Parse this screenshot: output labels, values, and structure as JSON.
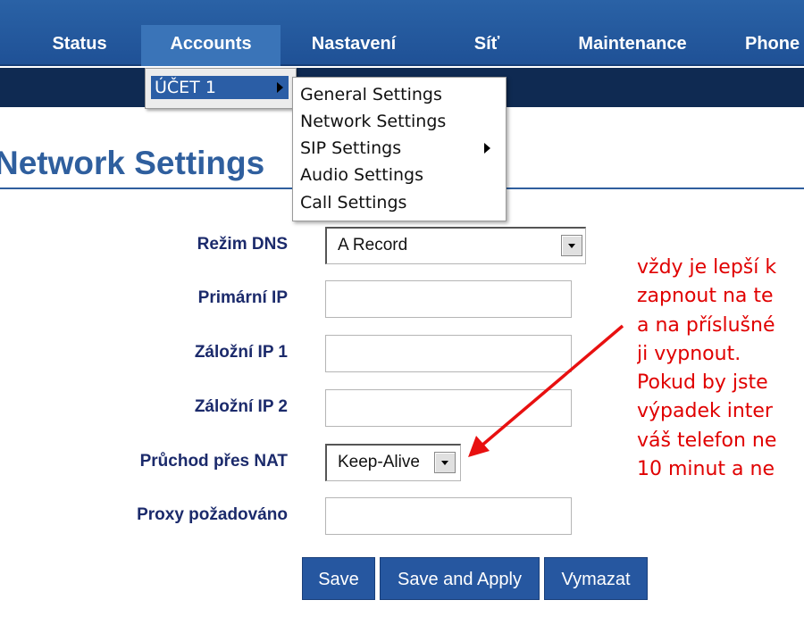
{
  "nav": {
    "tabs": [
      "Status",
      "Accounts",
      "Nastavení",
      "Síť",
      "Maintenance",
      "Phone"
    ],
    "active": "Accounts"
  },
  "accounts_menu": {
    "item": "ÚČET 1"
  },
  "account_submenu": {
    "items": [
      "General Settings",
      "Network Settings",
      "SIP Settings",
      "Audio Settings",
      "Call Settings"
    ]
  },
  "page": {
    "title": "Network Settings"
  },
  "form": {
    "dns_mode": {
      "label": "Režim DNS",
      "value": "A Record"
    },
    "primary_ip": {
      "label": "Primární IP",
      "value": ""
    },
    "backup_ip1": {
      "label": "Záložní IP 1",
      "value": ""
    },
    "backup_ip2": {
      "label": "Záložní IP 2",
      "value": ""
    },
    "nat_traversal": {
      "label": "Průchod přes NAT",
      "value": "Keep-Alive"
    },
    "proxy_required": {
      "label": "Proxy požadováno",
      "value": ""
    }
  },
  "buttons": {
    "save": "Save",
    "save_apply": "Save and Apply",
    "clear": "Vymazat"
  },
  "annotation": {
    "lines": [
      "vždy je lepší k",
      "zapnout na te",
      "a na příslušné",
      "ji vypnout.",
      "Pokud by jste",
      "výpadek inter",
      "váš telefon ne",
      "10 minut a ne"
    ],
    "color": "#e00000"
  },
  "colors": {
    "nav": "#2a62a6",
    "title": "#2f5f9e",
    "button": "#2657a0",
    "label": "#1b2a6b"
  }
}
